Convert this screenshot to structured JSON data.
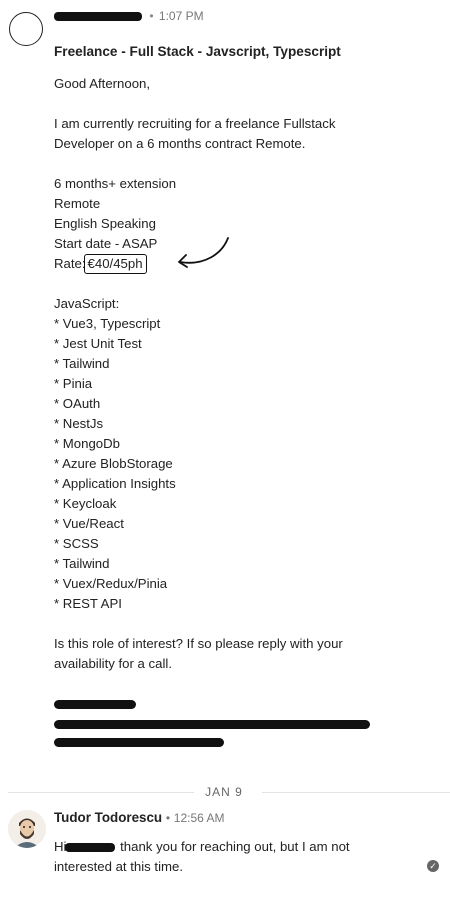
{
  "first_message": {
    "time": "1:07 PM",
    "separator": "•",
    "subject": "Freelance - Full Stack - Javscript, Typescript",
    "greeting": "Good Afternoon,",
    "intro_lines": [
      "I am currently recruiting for a freelance Fullstack",
      "Developer on a 6 months contract Remote."
    ],
    "details": [
      "6 months+ extension",
      "Remote",
      "English Speaking",
      "Start date - ASAP"
    ],
    "rate_label": "Rate:",
    "rate_value": "€40/45ph",
    "skills_heading": "JavaScript:",
    "skills": [
      "* Vue3, Typescript",
      "* Jest Unit Test",
      "* Tailwind",
      "* Pinia",
      "* OAuth",
      "* NestJs",
      "* MongoDb",
      "* Azure BlobStorage",
      "* Application Insights",
      "* Keycloak",
      "* Vue/React",
      "* SCSS",
      "* Tailwind",
      "* Vuex/Redux/Pinia",
      "* REST API"
    ],
    "closing_lines": [
      "Is this role of interest? If so please reply with your",
      "availability for a call."
    ]
  },
  "date_divider": "JAN 9",
  "reply": {
    "sender": "Tudor Todorescu",
    "separator": "•",
    "time": "12:56 AM",
    "text_start": "Hi",
    "text_line1_end": "thank you for reaching out, but I am not",
    "text_line2": "interested at this time."
  },
  "icons": {
    "sender_avatar": "avatar-placeholder-icon",
    "annotation_arrow": "curved-arrow-icon",
    "seen_status": "seen-check-icon"
  }
}
